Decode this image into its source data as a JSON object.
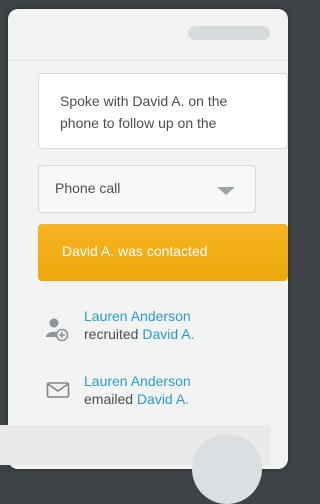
{
  "note": {
    "line1": "Spoke with David A. on the",
    "line2": "phone to follow up on the"
  },
  "contact_method": {
    "selected": "Phone call"
  },
  "status_banner": "David A. was contacted",
  "activities": [
    {
      "actor": "Lauren Anderson",
      "verb": "recruited",
      "target": "David A.",
      "icon": "add-user-icon"
    },
    {
      "actor": "Lauren Anderson",
      "verb": "emailed",
      "target": "David A.",
      "icon": "envelope-icon"
    }
  ],
  "colors": {
    "accent": "#f2b01a",
    "link": "#2a9bcf",
    "background": "#3e4347"
  }
}
